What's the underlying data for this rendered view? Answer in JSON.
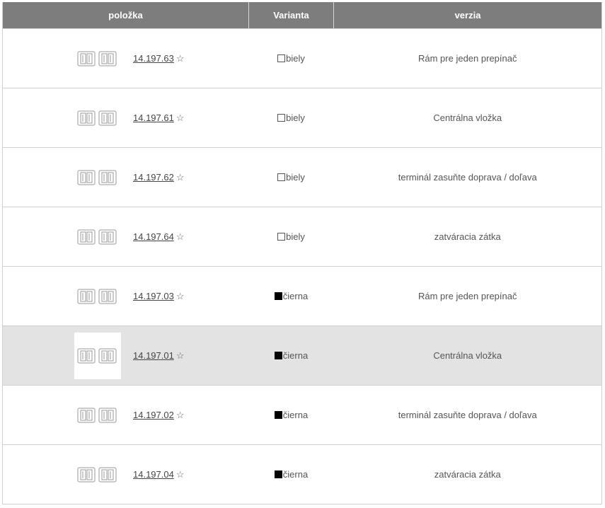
{
  "header": {
    "col_item": "položka",
    "col_variant": "Varianta",
    "col_version": "verzia"
  },
  "rows": [
    {
      "code": "14.197.63",
      "star": "☆",
      "swatch_color": "#ffffff",
      "variant": "biely",
      "version": "Rám pre jeden prepínač"
    },
    {
      "code": "14.197.61",
      "star": "☆",
      "swatch_color": "#ffffff",
      "variant": "biely",
      "version": "Centrálna vložka"
    },
    {
      "code": "14.197.62",
      "star": "☆",
      "swatch_color": "#ffffff",
      "variant": "biely",
      "version": "terminál zasuňte doprava / doľava"
    },
    {
      "code": "14.197.64",
      "star": "☆",
      "swatch_color": "#ffffff",
      "variant": "biely",
      "version": "zatváracia zátka"
    },
    {
      "code": "14.197.03",
      "star": "☆",
      "swatch_color": "#000000",
      "variant": "čierna",
      "version": "Rám pre jeden prepínač"
    },
    {
      "code": "14.197.01",
      "star": "☆",
      "swatch_color": "#000000",
      "variant": "čierna",
      "version": "Centrálna vložka"
    },
    {
      "code": "14.197.02",
      "star": "☆",
      "swatch_color": "#000000",
      "variant": "čierna",
      "version": "terminál zasuňte doprava / doľava"
    },
    {
      "code": "14.197.04",
      "star": "☆",
      "swatch_color": "#000000",
      "variant": "čierna",
      "version": "zatváracia zátka"
    }
  ],
  "colors": {
    "header_bg": "#7d7d7d",
    "highlight_row_bg": "#e3e3e3"
  },
  "icons": {
    "thumbnail": "product-thumbnail-icon",
    "favorite": "star-outline-icon"
  }
}
